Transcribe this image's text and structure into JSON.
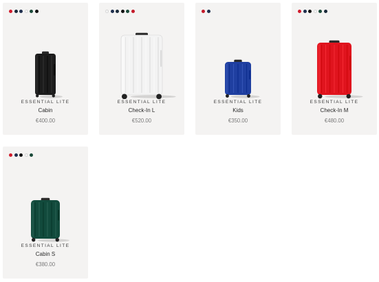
{
  "products": [
    {
      "collection": "ESSENTIAL LITE",
      "name": "Cabin",
      "price": "€400.00",
      "color": "#1c1c1c",
      "swatches": [
        "#d01b2c",
        "#1a2a3a",
        "#1f2f4e",
        "#f2f2f2",
        "#1b4a3a",
        "#111111"
      ]
    },
    {
      "collection": "ESSENTIAL LITE",
      "name": "Check-In L",
      "price": "€520.00",
      "color": "#f3f3f3",
      "swatches": [
        "#f2f2f2",
        "#1f2f4e",
        "#1a2a3a",
        "#111111",
        "#1b4a3a",
        "#c41a2a"
      ]
    },
    {
      "collection": "ESSENTIAL LITE",
      "name": "Kids",
      "price": "€350.00",
      "color": "#1f3fa0",
      "swatches": [
        "#c41a2a",
        "#1f2f4e"
      ]
    },
    {
      "collection": "ESSENTIAL LITE",
      "name": "Check-In M",
      "price": "€480.00",
      "color": "#e0141e",
      "swatches": [
        "#d01b2c",
        "#1f2f4e",
        "#111111",
        "#f2f2f2",
        "#1b4a3a",
        "#1a2a3a"
      ]
    },
    {
      "collection": "ESSENTIAL LITE",
      "name": "Cabin S",
      "price": "€380.00",
      "color": "#124a3c",
      "swatches": [
        "#d01b2c",
        "#1f2f4e",
        "#111111",
        "#f2f2f2",
        "#1b4a3a"
      ]
    }
  ]
}
